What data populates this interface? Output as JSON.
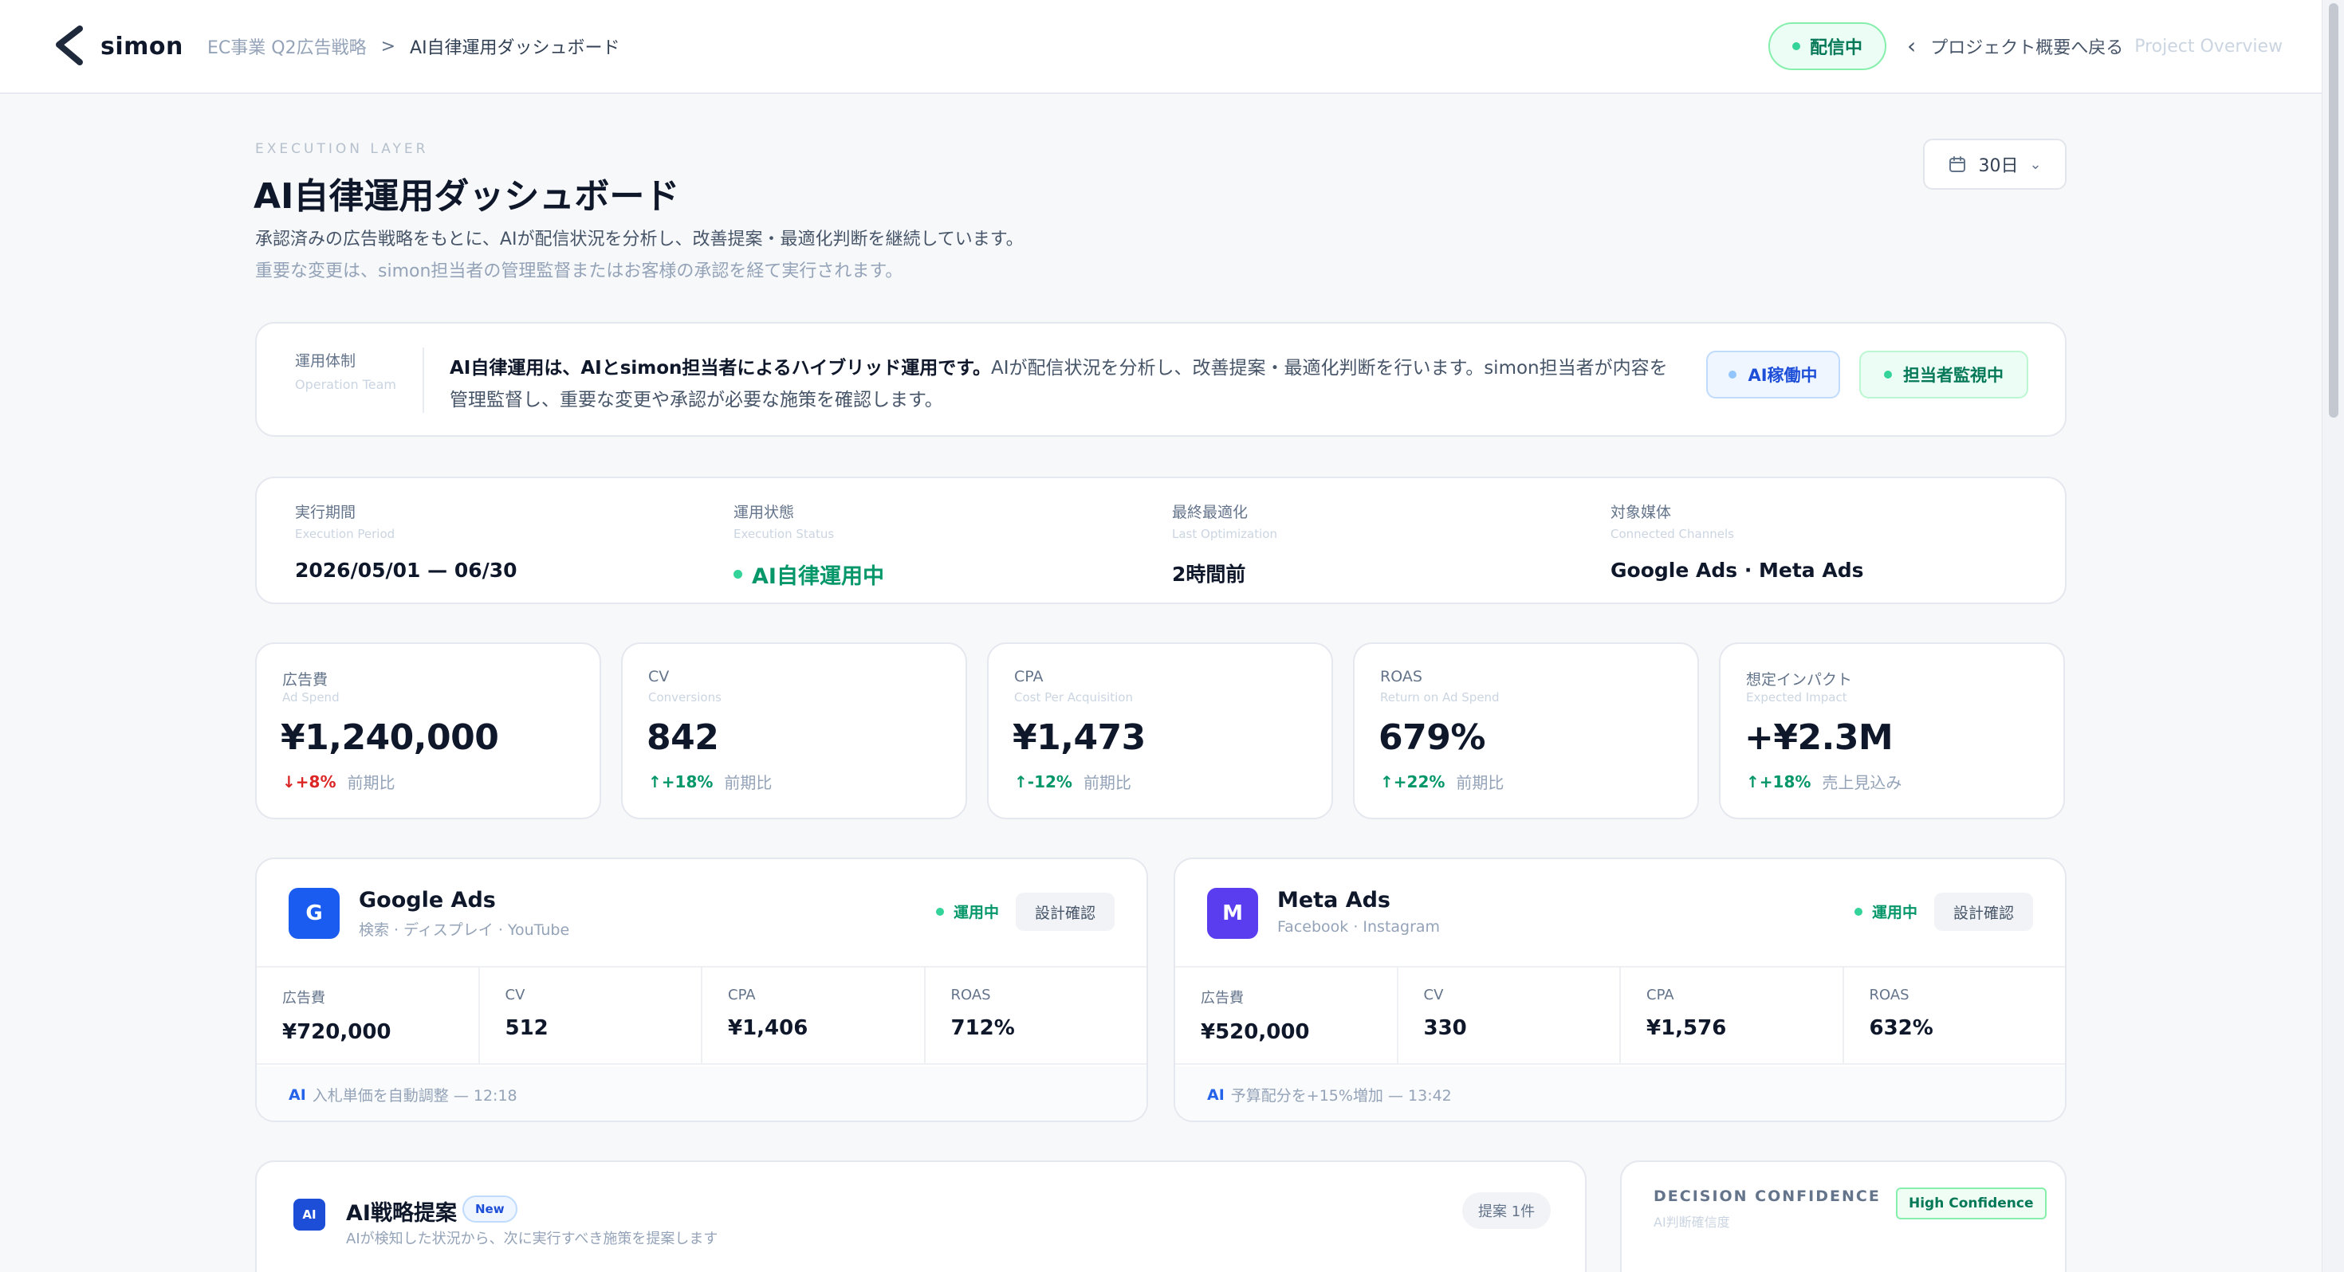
{
  "app": {
    "logo_text": "simon",
    "breadcrumb": [
      "EC事業 Q2広告戦略",
      "AI自律運用ダッシュボード"
    ],
    "breadcrumb_sep": ">",
    "live_status": "配信中",
    "back_label": "プロジェクト概要へ戻る",
    "back_label_en": "Project Overview"
  },
  "header": {
    "eyebrow": "EXECUTION LAYER",
    "title": "AI自律運用ダッシュボード",
    "desc1": "承認済みの広告戦略をもとに、AIが配信状況を分析し、改善提案・最適化判断を継続しています。",
    "desc2": "重要な変更は、simon担当者の管理監督またはお客様の承認を経て実行されます。",
    "range_label": "30日"
  },
  "ops": {
    "label": "運用体制",
    "label_en": "Operation Team",
    "text_bold": "AI自律運用は、AIとsimon担当者によるハイブリッド運用です。",
    "text_rest": "AIが配信状況を分析し、改善提案・最適化判断を行います。simon担当者が内容を管理監督し、重要な変更や承認が必要な施策を確認します。",
    "badge_ai": "AI稼働中",
    "badge_monitor": "担当者監視中"
  },
  "period": {
    "items": [
      {
        "label": "実行期間",
        "label_en": "Execution Period",
        "value": "2026/05/01 — 06/30"
      },
      {
        "label": "運用状態",
        "label_en": "Execution Status",
        "value": "AI自律運用中"
      },
      {
        "label": "最終最適化",
        "label_en": "Last Optimization",
        "value": "2時間前"
      },
      {
        "label": "対象媒体",
        "label_en": "Connected Channels",
        "value": "Google Ads · Meta Ads"
      }
    ]
  },
  "kpis": [
    {
      "label": "広告費",
      "label_en": "Ad Spend",
      "value": "¥1,240,000",
      "delta": "+8%",
      "delta_label": "前期比"
    },
    {
      "label": "CV",
      "label_en": "Conversions",
      "value": "842",
      "delta": "+18%",
      "delta_label": "前期比"
    },
    {
      "label": "CPA",
      "label_en": "Cost Per Acquisition",
      "value": "¥1,473",
      "delta": "-12%",
      "delta_label": "前期比"
    },
    {
      "label": "ROAS",
      "label_en": "Return on Ad Spend",
      "value": "679%",
      "delta": "+22%",
      "delta_label": "前期比"
    },
    {
      "label": "想定インパクト",
      "label_en": "Expected Impact",
      "value": "+¥2.3M",
      "delta": "+18%",
      "delta_label": "売上見込み"
    }
  ],
  "channels": [
    {
      "icon_letter": "G",
      "name": "Google Ads",
      "sub": "検索 · ディスプレイ · YouTube",
      "status": "運用中",
      "check_label": "設計確認",
      "metrics": [
        {
          "label": "広告費",
          "value": "¥720,000"
        },
        {
          "label": "CV",
          "value": "512"
        },
        {
          "label": "CPA",
          "value": "¥1,406"
        },
        {
          "label": "ROAS",
          "value": "712%"
        }
      ],
      "foot_ai": "AI",
      "foot_text": "入札単価を自動調整 — 12:18"
    },
    {
      "icon_letter": "M",
      "name": "Meta Ads",
      "sub": "Facebook · Instagram",
      "status": "運用中",
      "check_label": "設計確認",
      "metrics": [
        {
          "label": "広告費",
          "value": "¥520,000"
        },
        {
          "label": "CV",
          "value": "330"
        },
        {
          "label": "CPA",
          "value": "¥1,576"
        },
        {
          "label": "ROAS",
          "value": "632%"
        }
      ],
      "foot_ai": "AI",
      "foot_text": "予算配分を+15%増加 — 13:42"
    }
  ],
  "strategy": {
    "icon_text": "AI",
    "title": "AI戦略提案",
    "new_badge": "New",
    "sub": "AIが検知した状況から、次に実行すべき施策を提案します",
    "count": "提案 1件"
  },
  "confidence": {
    "title": "DECISION CONFIDENCE",
    "sub": "AI判断確信度",
    "badge": "High Confidence"
  },
  "colors": {
    "google_icon": "#1a5cf0",
    "meta_icon": "#5b3df0",
    "positive": "#059669",
    "negative": "#dc2626"
  }
}
